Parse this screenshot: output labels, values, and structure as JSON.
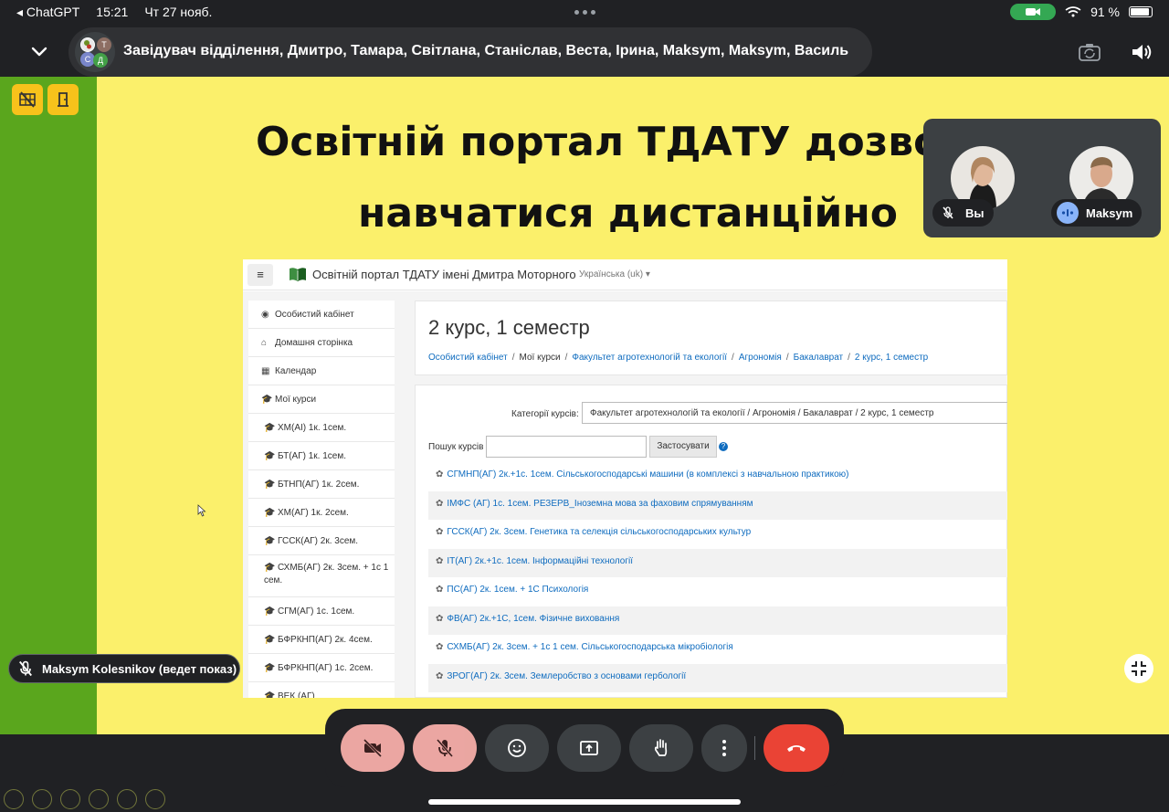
{
  "status_bar": {
    "back_app": "◂ ChatGPT",
    "time": "15:21",
    "date": "Чт 27 нояб.",
    "battery": "91 %"
  },
  "header": {
    "participants_title": "Завідувач відділення, Дмитро, Тамара, Світлана, Станіслав, Веста, Ірина, Maksym, Maksym, Василь",
    "avatar_letters": [
      "Т",
      "С",
      "Д"
    ]
  },
  "slide": {
    "title_line1": "Освітній портал ТДАТУ дозвол",
    "title_line2": "навчатися дистанційно",
    "portal": {
      "menu_icon": "≡",
      "site_title": "Освітній портал ТДАТУ імені Дмитра Моторного",
      "language": "Українська (uk) ▾",
      "sidebar": [
        {
          "icon": "dashboard-icon",
          "glyph": "◉",
          "label": "Особистий кабінет"
        },
        {
          "icon": "home-icon",
          "glyph": "⌂",
          "label": "Домашня сторінка"
        },
        {
          "icon": "calendar-icon",
          "glyph": "▦",
          "label": "Календар"
        },
        {
          "icon": "graduation-cap-icon",
          "glyph": "🎓",
          "label": "Мої курси"
        },
        {
          "icon": "graduation-cap-icon",
          "glyph": "🎓",
          "label": "ХМ(АІ) 1к. 1сем."
        },
        {
          "icon": "graduation-cap-icon",
          "glyph": "🎓",
          "label": "БТ(АГ) 1к. 1сем."
        },
        {
          "icon": "graduation-cap-icon",
          "glyph": "🎓",
          "label": "БТНП(АГ) 1к. 2сем."
        },
        {
          "icon": "graduation-cap-icon",
          "glyph": "🎓",
          "label": "ХМ(АГ) 1к. 2сем."
        },
        {
          "icon": "graduation-cap-icon",
          "glyph": "🎓",
          "label": "ГССК(АГ) 2к. 3сем."
        },
        {
          "icon": "graduation-cap-icon",
          "glyph": "🎓",
          "label": "СХМБ(АГ) 2к. 3сем. + 1с 1 сем."
        },
        {
          "icon": "graduation-cap-icon",
          "glyph": "🎓",
          "label": "СГМ(АГ) 1с. 1сем."
        },
        {
          "icon": "graduation-cap-icon",
          "glyph": "🎓",
          "label": "БФРКНП(АГ) 2к. 4сем."
        },
        {
          "icon": "graduation-cap-icon",
          "glyph": "🎓",
          "label": "БФРКНП(АГ) 1с. 2сем."
        },
        {
          "icon": "graduation-cap-icon",
          "glyph": "🎓",
          "label": "ВЕК (АГ)"
        }
      ],
      "page_title": "2 курс, 1 семестр",
      "breadcrumbs": [
        "Особистий кабінет",
        "Мої курси",
        "Факультет агротехнологій та екології",
        "Агрономія",
        "Бакалаврат",
        "2 курс, 1 семестр"
      ],
      "breadcrumb_sep": "/",
      "category_label": "Категорії курсів:",
      "category_value": "Факультет агротехнологій та екології / Агрономія / Бакалаврат / 2 курс, 1 семестр",
      "search_label": "Пошук курсів",
      "search_value": "",
      "apply_label": "Застосувати",
      "help_glyph": "?",
      "course_glyph": "✿",
      "courses": [
        "СГМНП(АГ) 2к.+1с. 1сем. Сільськогосподарські машини (в комплексі з навчальною практикою)",
        "ІМФС (АГ) 1с. 1сем. РЕЗЕРВ_Іноземна мова за фаховим спрямуванням",
        "ГССК(АГ) 2к. 3сем. Генетика та селекція сільськогосподарських культур",
        "ІТ(АГ) 2к.+1с. 1сем. Інформаційні технології",
        "ПС(АГ) 2к. 1сем. + 1С Психологія",
        "ФВ(АГ) 2к.+1С, 1сем. Фізичне виховання",
        "СХМБ(АГ) 2к. 3сем. + 1с 1 сем. Сільськогосподарська мікробіологія",
        "ЗРОГ(АГ) 2к. 3сем. Землеробство з основами гербології"
      ]
    }
  },
  "self_view": {
    "me_label": "Вы",
    "other_label": "Maksym"
  },
  "presenter_label": "Maksym Kolesnikov (ведет показ)",
  "colors": {
    "stage_yellow": "#fbf06b",
    "sidebar_green": "#5aa61d",
    "end_call_red": "#ea4335",
    "muted_pink": "#f6aea9",
    "link_blue": "#0f6cbf"
  }
}
